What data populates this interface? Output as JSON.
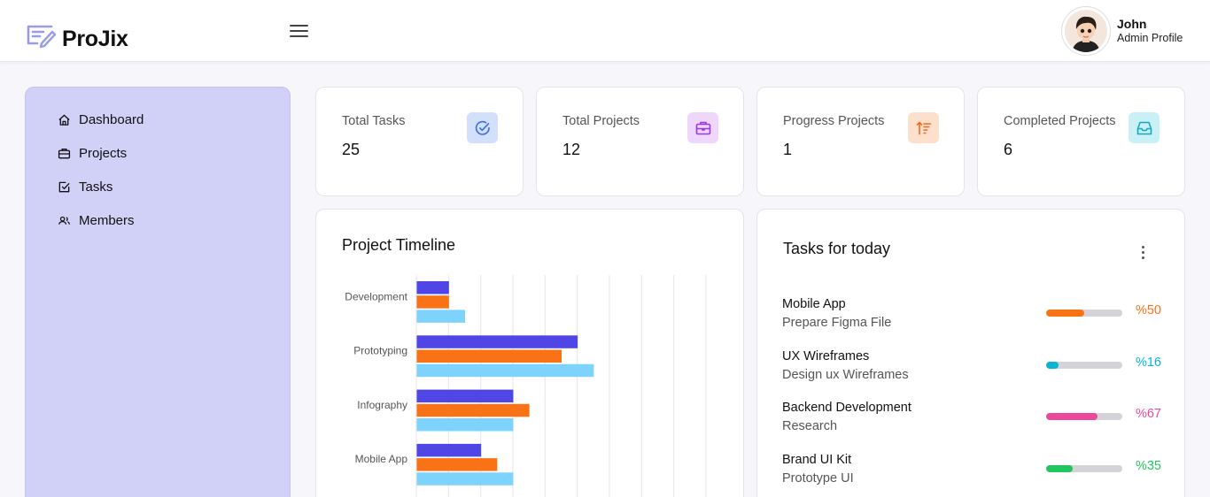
{
  "app": {
    "name": "ProJix"
  },
  "user": {
    "name": "John",
    "role": "Admin Profile"
  },
  "sidebar": {
    "items": [
      {
        "label": "Dashboard",
        "icon": "home-icon"
      },
      {
        "label": "Projects",
        "icon": "briefcase-icon"
      },
      {
        "label": "Tasks",
        "icon": "checkbox-icon"
      },
      {
        "label": "Members",
        "icon": "users-icon"
      }
    ]
  },
  "stats": [
    {
      "label": "Total Tasks",
      "value": "25",
      "icon": "check-circle-icon",
      "icon_bg": "#d3e0fb",
      "icon_color": "#3b6ee6"
    },
    {
      "label": "Total Projects",
      "value": "12",
      "icon": "briefcase-icon",
      "icon_bg": "#eed7fb",
      "icon_color": "#9b37e8"
    },
    {
      "label": "Progress Projects",
      "value": "1",
      "icon": "sort-arrow-icon",
      "icon_bg": "#fde0cc",
      "icon_color": "#ef6a20"
    },
    {
      "label": "Completed Projects",
      "value": "6",
      "icon": "inbox-icon",
      "icon_bg": "#c9f0f5",
      "icon_color": "#17a9c4"
    }
  ],
  "timeline": {
    "title": "Project Timeline"
  },
  "chart_data": {
    "type": "bar",
    "orientation": "horizontal",
    "title": "Project Timeline",
    "categories": [
      "Development",
      "Prototyping",
      "Infography",
      "Mobile App"
    ],
    "series": [
      {
        "values": [
          2,
          10,
          6,
          4
        ],
        "color": "#4f46e5"
      },
      {
        "values": [
          2,
          9,
          7,
          5
        ],
        "color": "#f97316"
      },
      {
        "values": [
          3,
          11,
          6,
          6
        ],
        "color": "#7dd3fc"
      }
    ],
    "xlim": [
      0,
      18
    ],
    "grid": true,
    "legend": "none"
  },
  "tasks": {
    "title": "Tasks for today",
    "items": [
      {
        "title": "Mobile App",
        "subtitle": "Prepare Figma File",
        "progress": 0.5,
        "label": "%50",
        "color": "#f97316"
      },
      {
        "title": "UX Wireframes",
        "subtitle": "Design ux Wireframes",
        "progress": 0.16,
        "label": "%16",
        "color": "#06b6d4"
      },
      {
        "title": "Backend Development",
        "subtitle": "Research",
        "progress": 0.67,
        "label": "%67",
        "color": "#ec4899"
      },
      {
        "title": "Brand UI Kit",
        "subtitle": "Prototype UI",
        "progress": 0.35,
        "label": "%35",
        "color": "#22c55e"
      }
    ]
  }
}
